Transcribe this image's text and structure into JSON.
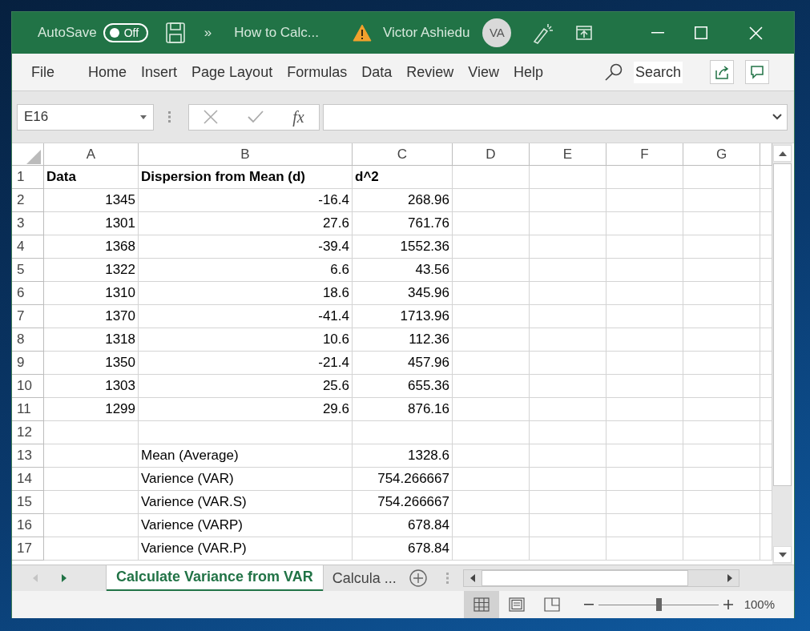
{
  "title_bar": {
    "autosave": {
      "label": "AutoSave",
      "state_text": "Off",
      "on": false
    },
    "more": "»",
    "document_title": "How to Calc...",
    "user_name": "Victor Ashiedu",
    "initials": "VA"
  },
  "menu": [
    {
      "label": "File"
    },
    {
      "label": "Home"
    },
    {
      "label": "Insert"
    },
    {
      "label": "Page Layout"
    },
    {
      "label": "Formulas"
    },
    {
      "label": "Data"
    },
    {
      "label": "Review"
    },
    {
      "label": "View"
    },
    {
      "label": "Help"
    }
  ],
  "search": {
    "placeholder": "Search"
  },
  "formula_bar": {
    "name_box": "E16",
    "function_label": "fx"
  },
  "columns": [
    "A",
    "B",
    "C",
    "D",
    "E",
    "F",
    "G"
  ],
  "rows": [
    {
      "number": "1",
      "kind": "header",
      "cells": [
        "Data",
        "Dispersion from Mean (d)",
        "d^2"
      ]
    },
    {
      "number": "2",
      "kind": "data",
      "cells": [
        "1345",
        "-16.4",
        "268.96"
      ]
    },
    {
      "number": "3",
      "kind": "data",
      "cells": [
        "1301",
        "27.6",
        "761.76"
      ]
    },
    {
      "number": "4",
      "kind": "data",
      "cells": [
        "1368",
        "-39.4",
        "1552.36"
      ]
    },
    {
      "number": "5",
      "kind": "data",
      "cells": [
        "1322",
        "6.6",
        "43.56"
      ]
    },
    {
      "number": "6",
      "kind": "data",
      "cells": [
        "1310",
        "18.6",
        "345.96"
      ]
    },
    {
      "number": "7",
      "kind": "data",
      "cells": [
        "1370",
        "-41.4",
        "1713.96"
      ]
    },
    {
      "number": "8",
      "kind": "data",
      "cells": [
        "1318",
        "10.6",
        "112.36"
      ]
    },
    {
      "number": "9",
      "kind": "data",
      "cells": [
        "1350",
        "-21.4",
        "457.96"
      ]
    },
    {
      "number": "10",
      "kind": "data",
      "cells": [
        "1303",
        "25.6",
        "655.36"
      ]
    },
    {
      "number": "11",
      "kind": "data",
      "cells": [
        "1299",
        "29.6",
        "876.16"
      ]
    },
    {
      "number": "12",
      "kind": "data",
      "cells": [
        null,
        null,
        null
      ]
    },
    {
      "number": "13",
      "kind": "summary",
      "cells": [
        null,
        "Mean (Average)",
        "1328.6"
      ]
    },
    {
      "number": "14",
      "kind": "summary",
      "cells": [
        null,
        "Varience (VAR)",
        "754.266667"
      ]
    },
    {
      "number": "15",
      "kind": "summary",
      "cells": [
        null,
        "Varience (VAR.S)",
        "754.266667"
      ]
    },
    {
      "number": "16",
      "kind": "summary",
      "cells": [
        null,
        "Varience (VARP)",
        "678.84"
      ]
    },
    {
      "number": "17",
      "kind": "summary",
      "cells": [
        null,
        "Varience (VAR.P)",
        "678.84"
      ]
    }
  ],
  "sheet_nav": [
    {
      "kind": "prev",
      "disabled": true
    },
    {
      "kind": "next",
      "disabled": false
    }
  ],
  "sheet_tabs": [
    {
      "label": "Calculate Variance from VAR",
      "selected": true
    },
    {
      "label": "Calcula ...",
      "selected": false
    }
  ],
  "status_bar": {
    "views": [
      {
        "kind": "normal",
        "selected": true
      },
      {
        "kind": "page-layout",
        "selected": false
      },
      {
        "kind": "page-break",
        "selected": false
      }
    ],
    "zoom": {
      "level": 0.5,
      "reading": "100%"
    }
  }
}
